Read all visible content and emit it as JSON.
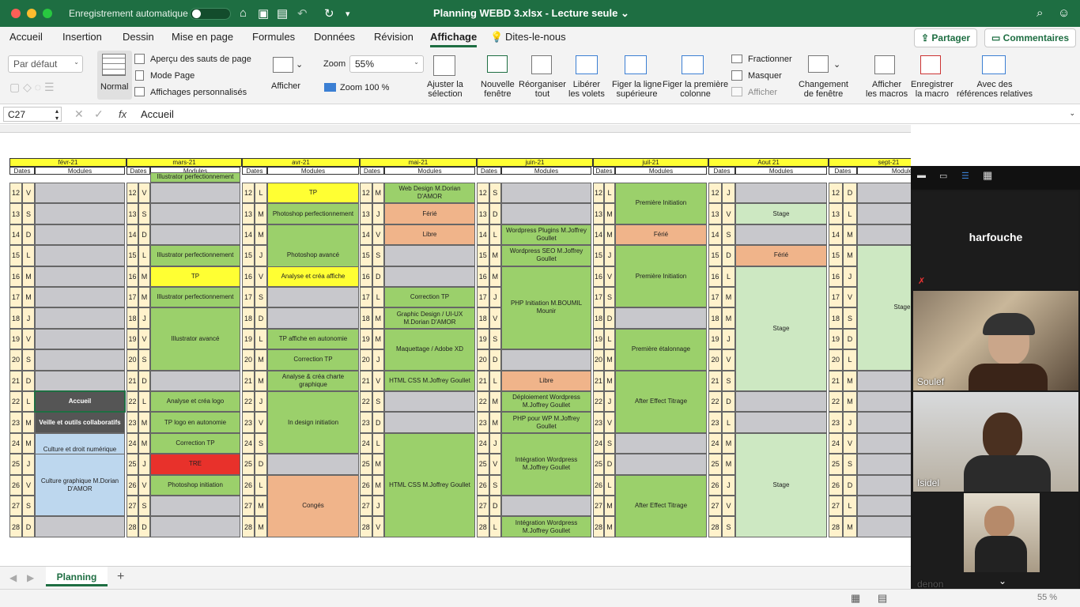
{
  "titlebar": {
    "autosave_label": "Enregistrement automatique",
    "doc_title": "Planning WEBD 3.xlsx  -  Lecture seule ⌄"
  },
  "ribbon_tabs": [
    "Accueil",
    "Insertion",
    "Dessin",
    "Mise en page",
    "Formules",
    "Données",
    "Révision",
    "Affichage",
    "Dites-le-nous"
  ],
  "buttons": {
    "share": "Partager",
    "comments": "Commentaires"
  },
  "ribbon": {
    "view_select": "Par défaut",
    "normal": "Normal",
    "page_breaks": "Aperçu des sauts de page",
    "page_mode": "Mode Page",
    "custom_views": "Affichages personnalisés",
    "show": "Afficher",
    "zoom_label": "Zoom",
    "zoom_value": "55%",
    "zoom100": "Zoom 100 %",
    "fit_sel": "Ajuster la\nsélection",
    "new_window": "Nouvelle\nfenêtre",
    "arrange": "Réorganiser\ntout",
    "unfreeze": "Libérer\nles volets",
    "freeze_top": "Figer la ligne\nsupérieure",
    "freeze_first": "Figer la première\ncolonne",
    "split": "Fractionner",
    "hide": "Masquer",
    "unhide": "Afficher",
    "switch": "Changement\nde fenêtre",
    "macros": "Afficher\nles macros",
    "record": "Enregistrer\nla macro",
    "relative": "Avec des\nréférences relatives"
  },
  "formula_bar": {
    "cell": "C27",
    "fx": "fx",
    "value": "Accueil"
  },
  "months": [
    {
      "name": "févr-21",
      "dates": "Dates",
      "modules": "Modules"
    },
    {
      "name": "mars-21",
      "dates": "Dates",
      "modules": "Modules"
    },
    {
      "name": "avr-21",
      "dates": "Dates",
      "modules": "Modules"
    },
    {
      "name": "mai-21",
      "dates": "Dates",
      "modules": "Modules"
    },
    {
      "name": "juin-21",
      "dates": "Dates",
      "modules": "Modules"
    },
    {
      "name": "juil-21",
      "dates": "Dates",
      "modules": "Modules"
    },
    {
      "name": "Aout 21",
      "dates": "Dates",
      "modules": "Modules"
    },
    {
      "name": "sept-21",
      "dates": "Dates",
      "modules": "Module"
    }
  ],
  "days": [
    "12",
    "13",
    "14",
    "15",
    "16",
    "17",
    "18",
    "19",
    "20",
    "21",
    "22",
    "23",
    "24",
    "25",
    "26",
    "27",
    "28"
  ],
  "weekdays": [
    [
      "V",
      "S",
      "D",
      "L",
      "M",
      "M",
      "J",
      "V",
      "S",
      "D",
      "L",
      "M",
      "M",
      "J",
      "V",
      "S",
      "D"
    ],
    [
      "V",
      "S",
      "D",
      "L",
      "M",
      "M",
      "J",
      "V",
      "S",
      "D",
      "L",
      "M",
      "M",
      "J",
      "V",
      "S",
      "D"
    ],
    [
      "L",
      "M",
      "M",
      "J",
      "V",
      "S",
      "D",
      "L",
      "M",
      "M",
      "J",
      "V",
      "S",
      "D",
      "L",
      "M",
      "M"
    ],
    [
      "M",
      "J",
      "V",
      "S",
      "D",
      "L",
      "M",
      "M",
      "J",
      "V",
      "S",
      "D",
      "L",
      "M",
      "M",
      "J",
      "V"
    ],
    [
      "S",
      "D",
      "L",
      "M",
      "M",
      "J",
      "V",
      "S",
      "D",
      "L",
      "M",
      "M",
      "J",
      "V",
      "S",
      "D",
      "L"
    ],
    [
      "L",
      "M",
      "M",
      "J",
      "V",
      "S",
      "D",
      "L",
      "M",
      "M",
      "J",
      "V",
      "S",
      "D",
      "L",
      "M",
      "M"
    ],
    [
      "J",
      "V",
      "S",
      "D",
      "L",
      "M",
      "M",
      "J",
      "V",
      "S",
      "D",
      "L",
      "M",
      "M",
      "J",
      "V",
      "S"
    ],
    [
      "D",
      "L",
      "M",
      "M",
      "J",
      "V",
      "S",
      "D",
      "L",
      "M",
      "M",
      "J",
      "V",
      "S",
      "D",
      "L",
      "M"
    ]
  ],
  "modules": {
    "feb": [
      {
        "r": 10,
        "t": "Accueil"
      },
      {
        "r": 11,
        "t": "Veille et outils collaboratifs"
      },
      {
        "r": 12,
        "t": "Culture et droit numérique M.Dorian D'AMOR"
      },
      {
        "r": 13,
        "t": "Culture graphique M.Dorian D'AMOR"
      }
    ],
    "mar": [
      {
        "r": -1,
        "t": "Illustrator perfectionnement"
      },
      {
        "r": 3,
        "t": "Illustrator perfectionnement"
      },
      {
        "r": 4,
        "t": "TP"
      },
      {
        "r": 5,
        "t": "Illustrator perfectionnement"
      },
      {
        "r": 6,
        "t": "Illustrator avancé"
      },
      {
        "r": 10,
        "t": "Analyse et créa logo"
      },
      {
        "r": 11,
        "t": "TP logo en autonomie"
      },
      {
        "r": 12,
        "t": "Correction TP"
      },
      {
        "r": 13,
        "t": "TRE"
      },
      {
        "r": 14,
        "t": "Photoshop initiation"
      }
    ],
    "apr": [
      {
        "r": 0,
        "t": "TP"
      },
      {
        "r": 1,
        "t": "Photoshop perfectionnement"
      },
      {
        "r": 2,
        "t": "Photoshop avancé"
      },
      {
        "r": 4,
        "t": "Analyse et créa affiche"
      },
      {
        "r": 7,
        "t": "TP affiche en autonomie"
      },
      {
        "r": 8,
        "t": "Correction TP"
      },
      {
        "r": 9,
        "t": "Analyse & créa charte graphique"
      },
      {
        "r": 10,
        "t": "In design initiation"
      },
      {
        "r": 14,
        "t": "Congés"
      }
    ],
    "may": [
      {
        "r": 0,
        "t": "Web Design M.Dorian D'AMOR"
      },
      {
        "r": 1,
        "t": "Férié"
      },
      {
        "r": 2,
        "t": "Libre"
      },
      {
        "r": 5,
        "t": "Correction TP"
      },
      {
        "r": 6,
        "t": "Graphic Design / UI-UX M.Dorian D'AMOR"
      },
      {
        "r": 7,
        "t": "Maquettage / Adobe XD"
      },
      {
        "r": 9,
        "t": "HTML CSS M.Joffrey Goullet"
      },
      {
        "r": 12,
        "t": "HTML CSS M.Joffrey Goullet"
      }
    ],
    "jun": [
      {
        "r": 2,
        "t": "Wordpress Plugins M.Joffrey Goullet"
      },
      {
        "r": 3,
        "t": "Wordpress SEO M.Joffrey Goullet"
      },
      {
        "r": 4,
        "t": "PHP Initiation M.BOUMIL Mounir"
      },
      {
        "r": 9,
        "t": "Libre"
      },
      {
        "r": 10,
        "t": "Déploiement Wordpress M.Joffrey Goullet"
      },
      {
        "r": 11,
        "t": "PHP pour WP M.Joffrey Goullet"
      },
      {
        "r": 12,
        "t": "Intégration Wordpress M.Joffrey Goullet"
      },
      {
        "r": 16,
        "t": "Intégration Wordpress M.Joffrey Goullet"
      }
    ],
    "jul": [
      {
        "r": 0,
        "t": "Première Initiation"
      },
      {
        "r": 2,
        "t": "Férié"
      },
      {
        "r": 3,
        "t": "Première Initiation"
      },
      {
        "r": 7,
        "t": "Première étalonnage"
      },
      {
        "r": 9,
        "t": "After Effect Titrage"
      },
      {
        "r": 14,
        "t": "After Effect Titrage"
      }
    ],
    "aug": [
      {
        "r": 1,
        "t": "Stage"
      },
      {
        "r": 3,
        "t": "Férié"
      },
      {
        "r": 4,
        "t": "Stage"
      },
      {
        "r": 12,
        "t": "Stage"
      }
    ],
    "sep": [
      {
        "r": 3,
        "t": "Stage"
      }
    ]
  },
  "participants": [
    {
      "name": "harfouche"
    },
    {
      "name": "Soulef"
    },
    {
      "name": "Isidel"
    },
    {
      "name": "denon"
    }
  ],
  "sheet_tab": "Planning",
  "status": {
    "zoom": "55 %"
  }
}
